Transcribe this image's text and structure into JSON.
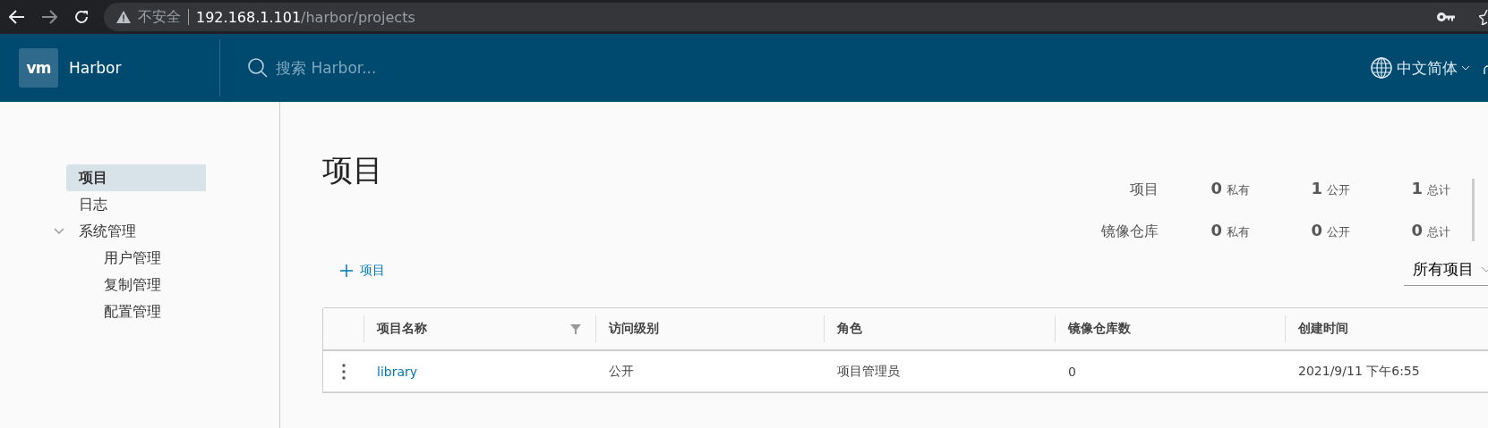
{
  "browser": {
    "forward_disabled": true,
    "security_label": "不安全",
    "url_host": "192.168.1.101",
    "url_path": "/harbor/projects"
  },
  "header": {
    "logo": "vm",
    "product": "Harbor",
    "search": {
      "placeholder": "搜索 Harbor..."
    },
    "language": "中文简体"
  },
  "sidebar": {
    "items": [
      {
        "label": "项目",
        "selected": true
      },
      {
        "label": "日志",
        "selected": false
      },
      {
        "label": "系统管理",
        "selected": false,
        "expanded": true,
        "children": [
          {
            "label": "用户管理",
            "selected": false
          },
          {
            "label": "复制管理",
            "selected": false
          },
          {
            "label": "配置管理",
            "selected": false
          }
        ]
      }
    ]
  },
  "page": {
    "title": "项目",
    "stats": [
      {
        "label": "项目",
        "cells": [
          {
            "count": "0",
            "label": "私有"
          },
          {
            "count": "1",
            "label": "公开"
          },
          {
            "count": "1",
            "label": "总计"
          }
        ]
      },
      {
        "label": "镜像仓库",
        "cells": [
          {
            "count": "0",
            "label": "私有"
          },
          {
            "count": "0",
            "label": "公开"
          },
          {
            "count": "0",
            "label": "总计"
          }
        ]
      }
    ],
    "add_button": "项目",
    "filter": "所有项目"
  },
  "table": {
    "columns": [
      {
        "label": "项目名称",
        "filterable": true
      },
      {
        "label": "访问级别",
        "filterable": false
      },
      {
        "label": "角色",
        "filterable": false
      },
      {
        "label": "镜像仓库数",
        "filterable": false
      },
      {
        "label": "创建时间",
        "filterable": false
      }
    ],
    "rows": [
      {
        "name": "library",
        "access": "公开",
        "role": "项目管理员",
        "repositories": "0",
        "created": "2021/9/11 下午6:55"
      }
    ]
  }
}
